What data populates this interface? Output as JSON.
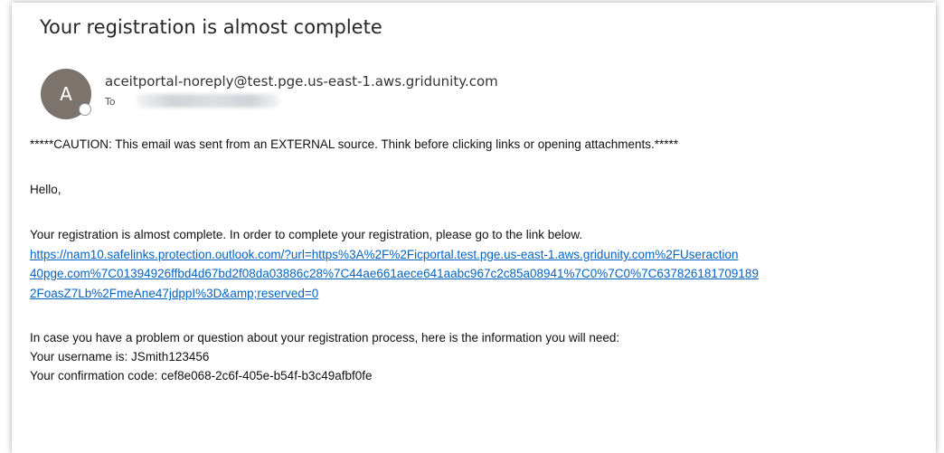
{
  "email": {
    "subject": "Your registration is almost complete",
    "avatar_initial": "A",
    "sender": "aceitportal-noreply@test.pge.us-east-1.aws.gridunity.com",
    "to_label": "To",
    "caution": "*****CAUTION: This email was sent from an EXTERNAL source. Think before clicking links or opening attachments.*****",
    "greeting": "Hello,",
    "paragraph1": "Your registration is almost complete.  In order to complete your registration, please go to the link below.",
    "link_lines": [
      "https://nam10.safelinks.protection.outlook.com/?url=https%3A%2F%2Ficportal.test.pge.us-east-1.aws.gridunity.com%2FUseraction",
      "40pge.com%7C01394926ffbd4d67bd2f08da03886c28%7C44ae661aece641aabc967c2c85a08941%7C0%7C0%7C637826181709189",
      "2FoasZ7Lb%2FmeAne47jdppI%3D&amp;reserved=0"
    ],
    "paragraph2": "In case you have a problem or question about your registration process, here is the information you will need:",
    "username_line": "Your username is: JSmith123456",
    "confirmation_line": "Your confirmation code: cef8e068-2c6f-405e-b54f-b3c49afbf0fe"
  },
  "colors": {
    "link": "#0563c1",
    "avatar": "#7d736d"
  }
}
